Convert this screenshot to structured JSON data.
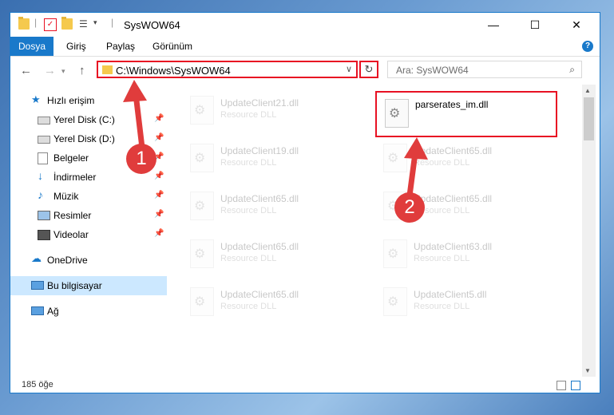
{
  "window": {
    "title": "SysWOW64"
  },
  "ribbon": {
    "tabs": [
      "Dosya",
      "Giriş",
      "Paylaş",
      "Görünüm"
    ],
    "help": "?"
  },
  "address": {
    "path": "C:\\Windows\\SysWOW64",
    "search_placeholder": "Ara: SysWOW64"
  },
  "sidebar": {
    "quick_access": "Hızlı erişim",
    "items": [
      "Yerel Disk (C:)",
      "Yerel Disk (D:)",
      "Belgeler",
      "İndirmeler",
      "Müzik",
      "Resimler",
      "Videolar"
    ],
    "onedrive": "OneDrive",
    "this_pc": "Bu bilgisayar",
    "network": "Ağ"
  },
  "files": [
    {
      "name": "UpdateClient21.dll",
      "type": "Resource DLL"
    },
    {
      "name": "parserates_im.dll",
      "type": ""
    },
    {
      "name": "UpdateClient19.dll",
      "type": "Resource DLL"
    },
    {
      "name": "UpdateClient65.dll",
      "type": "Resource DLL"
    },
    {
      "name": "UpdateClient65.dll",
      "type": "Resource DLL"
    },
    {
      "name": "UpdateClient65.dll",
      "type": "Resource DLL"
    },
    {
      "name": "UpdateClient65.dll",
      "type": "Resource DLL"
    },
    {
      "name": "UpdateClient63.dll",
      "type": "Resource DLL"
    },
    {
      "name": "UpdateClient65.dll",
      "type": "Resource DLL"
    },
    {
      "name": "UpdateClient5.dll",
      "type": "Resource DLL"
    }
  ],
  "status": {
    "count": "185 öğe"
  },
  "markers": {
    "one": "1",
    "two": "2"
  }
}
